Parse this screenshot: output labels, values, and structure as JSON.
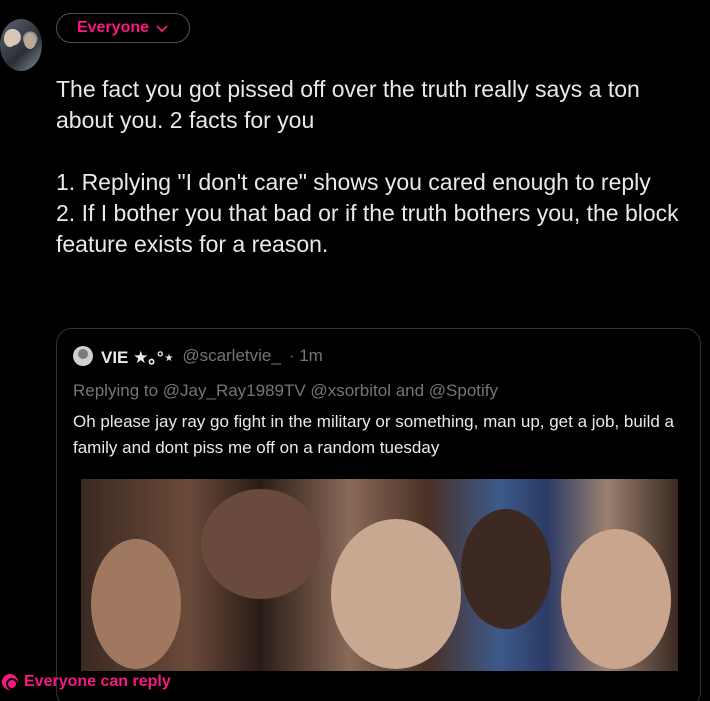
{
  "audience": {
    "label": "Everyone"
  },
  "tweet": {
    "paragraphs": [
      "The fact you got pissed off over the truth really says a ton about you. 2 facts for you",
      "1. Replying \"I don't care\" shows you cared enough to reply",
      "2. If I bother you that bad or if the truth bothers you, the block feature exists for a reason."
    ]
  },
  "quote": {
    "name": "VIE ★｡°⋆",
    "handle": "@scarletvie_",
    "time": "· 1m",
    "replying_to": "Replying to @Jay_Ray1989TV @xsorbitol and @Spotify",
    "text": "Oh please jay ray go fight in the military or something, man up, get a job, build a family and dont piss me off on a random tuesday"
  },
  "footer": {
    "reply_setting": "Everyone can reply"
  },
  "colors": {
    "accent": "#f91880",
    "muted": "#71767b",
    "text": "#e7e9ea",
    "border": "#2f3336"
  }
}
